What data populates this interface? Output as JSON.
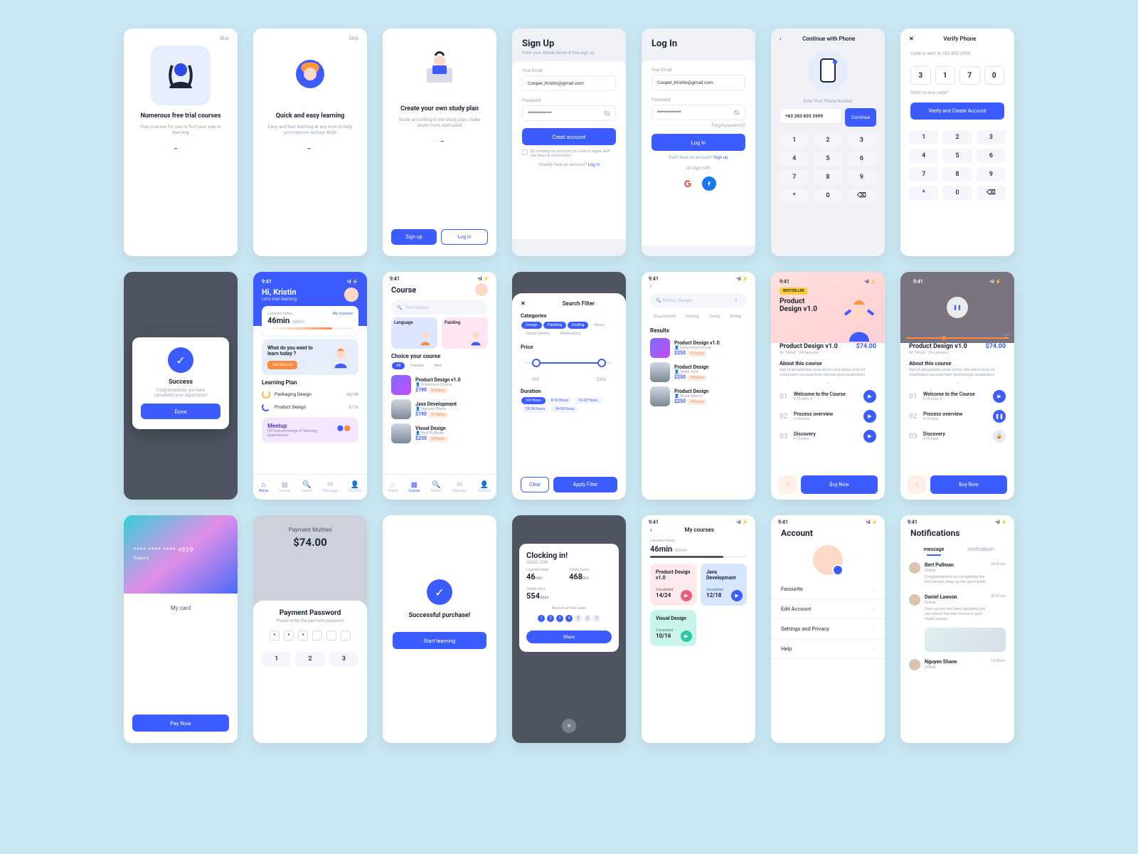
{
  "common": {
    "skip": "Skip",
    "time": "9:41",
    "signup": "Sign up",
    "login": "Log in"
  },
  "ob1": {
    "title": "Numerous free trial courses",
    "sub": "Free courses for you to find your way to learning"
  },
  "ob2": {
    "title": "Quick and easy learning",
    "sub": "Easy and fast learning at any time to help you improve various skills"
  },
  "ob3": {
    "title": "Create your own study plan",
    "sub": "Study according to the study plan, make study more motivated"
  },
  "signup": {
    "title": "Sign Up",
    "sub": "Enter your details below & free sign up",
    "emailLbl": "Your Email",
    "email": "Cooper_Kristin@gmail.com",
    "pwdLbl": "Password",
    "pwd": "************",
    "btn": "Creat account",
    "chk": "By creating an account you have to agree with our them & condication.",
    "already": "Already have an account?"
  },
  "loginScr": {
    "title": "Log In",
    "emailLbl": "Your Email",
    "email": "Cooper_Kristin@gmail.com",
    "pwdLbl": "Password",
    "pwd": "************",
    "forgot": "Forget password?",
    "btn": "Log In",
    "noacct": "Don't have an account? ",
    "signuplink": "Sign up",
    "orlogin": "Or login with"
  },
  "phone": {
    "title": "Continue with Phone",
    "enter": "Enter Your  Phone Number",
    "num": "+63 283 835 2999",
    "continue": "Continue",
    "keys": [
      "1",
      "2",
      "3",
      "4",
      "5",
      "6",
      "7",
      "8",
      "9",
      "*",
      "0",
      "⌫"
    ]
  },
  "verify": {
    "title": "Verify Phone",
    "sub": "Code is sent to 283 835 2999",
    "digits": [
      "3",
      "1",
      "7",
      "0"
    ],
    "resend": "Didn't recieve code?",
    "btn": "Verify and Create Account"
  },
  "success": {
    "title": "Success",
    "sub": "Congratulations, you have completed your registration!",
    "btn": "Done"
  },
  "home": {
    "greet": "Hi, Kristin",
    "sub": "Let's start learning",
    "learnedLbl": "Learned today",
    "mycourses": "My courses",
    "mins": "46min",
    "goal": "/ 60min",
    "promptTitle": "What do you want to learn today ?",
    "promptBtn": "Get Started",
    "lpTitle": "Learning Plan",
    "lp1": "Packaging Design",
    "lp1v": "40/48",
    "lp2": "Product Design",
    "lp2v": "6/24",
    "meetupTitle": "Meetup",
    "meetupSub": "Off-line exchange of learning experiences"
  },
  "course": {
    "title": "Course",
    "search": "Find Course",
    "cat1": "Language",
    "cat2": "Painting",
    "choice": "Choice your course",
    "tabs": [
      "All",
      "Popular",
      "New"
    ],
    "items": [
      {
        "name": "Product Design v1.0",
        "author": "Robertson Connie",
        "price": "$190",
        "hours": "16 hours"
      },
      {
        "name": "Java Development",
        "author": "Nguyen Shane",
        "price": "$190",
        "hours": "16 hours"
      },
      {
        "name": "Visual Design",
        "author": "Bert Pullman",
        "price": "$250",
        "hours": "14 hours"
      }
    ]
  },
  "filter": {
    "title": "Search Filter",
    "catLbl": "Categories",
    "cats": [
      "Design",
      "Painting",
      "Coding",
      "Music",
      "Visual identity",
      "Mathmatics"
    ],
    "priceLbl": "Price",
    "min": "$90",
    "max": "$200",
    "durLbl": "Duration",
    "durs": [
      "3-8 Hours",
      "8-14 Hours",
      "14-20 Hours",
      "20-24 Hours",
      "24-30 Hours"
    ],
    "clear": "Clear",
    "apply": "Apply Filter"
  },
  "results": {
    "search": "Product Design",
    "chips": [
      "Visual identity",
      "Painting",
      "Coding",
      "Writing"
    ],
    "title": "Results",
    "items": [
      {
        "name": "Product Design v1.0",
        "author": "Robertson Connie",
        "price": "$250",
        "hours": "16 hours"
      },
      {
        "name": "Product Design",
        "author": "Webb Kyle",
        "price": "$250",
        "hours": "14 hours"
      },
      {
        "name": "Product Design",
        "author": "Black Marvin",
        "price": "$250",
        "hours": "14 hours"
      }
    ]
  },
  "detail": {
    "best": "BESTSELLER",
    "title": "Product Design v1.0",
    "h2": "Product Design v1.0",
    "price": "$74.00",
    "meta": "6h 14min · 24 Lessons",
    "about": "About this course",
    "aboutTxt": "Sed ut perspiciatis unde omnis iste natus error sit voluptatem accusantium doloremque laudantium",
    "lessons": [
      {
        "n": "01",
        "t": "Welcome to the Course",
        "m": "6:10   mins",
        "done": true
      },
      {
        "n": "02",
        "t": "Process overview",
        "m": "6:10   mins",
        "done": false
      },
      {
        "n": "03",
        "t": "Discovery",
        "m": "6:10   mins",
        "done": false
      }
    ],
    "buy": "Buy Now"
  },
  "card": {
    "masked": "**** **** **** 4829",
    "balance": "Balance",
    "mycard": "My card",
    "pay": "Pay Now"
  },
  "paypwd": {
    "topTitle": "Payment Muthed",
    "amount": "$74.00",
    "title": "Payment Password",
    "sub": "Please enter the payment password",
    "keys": [
      "1",
      "2",
      "3"
    ]
  },
  "purchase": {
    "title": "Successful purchase!",
    "btn": "Start learning"
  },
  "clock": {
    "title": "Clocking in!",
    "sub": "GOOD JOB!",
    "s1l": "Learned today",
    "s1": "46",
    "s1u": "min",
    "s2l": "Totally hours",
    "s2": "468",
    "s2u": "hrs",
    "s3l": "Totally days",
    "s3": "554",
    "s3u": "days",
    "rec": "Record of this week",
    "days": [
      "1",
      "2",
      "3",
      "4",
      "5",
      "6",
      "7"
    ],
    "share": "Share"
  },
  "myc": {
    "title": "My courses",
    "learnedLbl": "Learned today",
    "mins": "46min",
    "goal": "/ 60min",
    "c1": "Product Design v1.0",
    "c1c": "Completed",
    "c1v": "14/24",
    "c2": "Java Developmant",
    "c2c": "Completed",
    "c2v": "12/18",
    "c3": "Visual Design",
    "c3c": "Completed",
    "c3v": "10/16"
  },
  "acct": {
    "title": "Account",
    "items": [
      "Favourite",
      "Edit Account",
      "Settings and Privacy",
      "Help"
    ]
  },
  "notif": {
    "title": "Notifications",
    "tab1": "message",
    "tab2": "notification",
    "msgs": [
      {
        "name": "Bert Pullman",
        "status": "Online",
        "time": "04:32 pm",
        "txt": "Congratulations on completing the first lesson, keep up the good work!"
      },
      {
        "name": "Daniel Lawson",
        "status": "Online",
        "time": "04:32 pm",
        "txt": "Your course has been updated, you can check the new course in your study course."
      },
      {
        "name": "Nguyen Shane",
        "status": "Online",
        "time": "12:00 am",
        "txt": ""
      }
    ]
  },
  "tabs": [
    "Home",
    "Course",
    "Search",
    "Message",
    "Account"
  ]
}
